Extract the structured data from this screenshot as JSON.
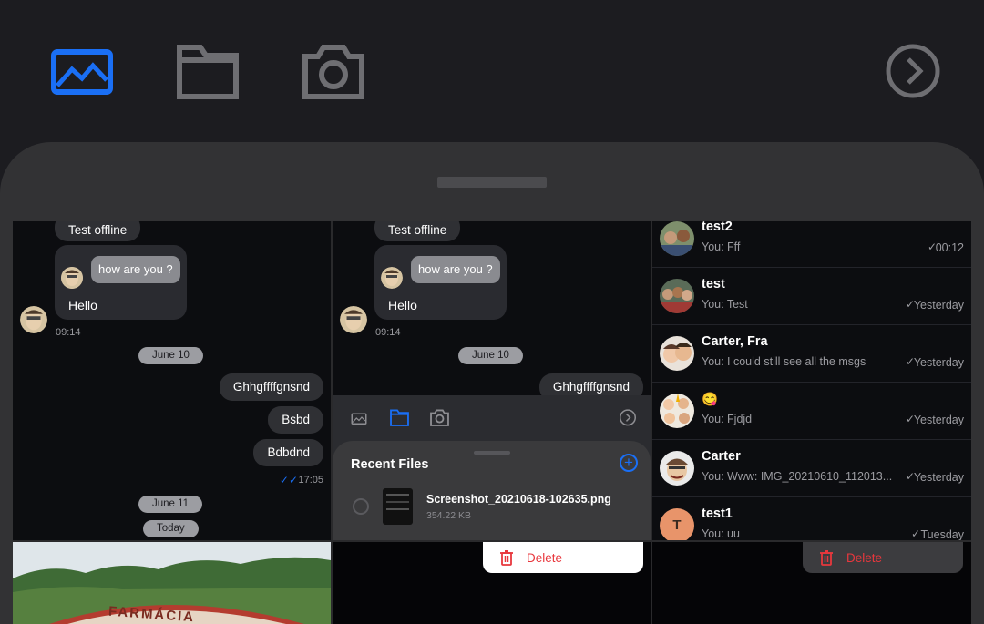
{
  "toolbar": {
    "icons": [
      "gallery-icon",
      "folder-icon",
      "camera-icon",
      "next-icon"
    ],
    "active_color": "#1a6ff5",
    "inactive_color": "#6e6e72"
  },
  "chat": {
    "offline_label": "Test offline",
    "incoming_question": "how are you ?",
    "incoming_reply": "Hello",
    "incoming_time": "09:14",
    "date_chip_1": "June 10",
    "outgoing": [
      "Ghhgffffgnsnd",
      "Bsbd",
      "Bdbdnd"
    ],
    "outgoing_time": "17:05",
    "date_chip_2": "June 11",
    "date_chip_3": "Today"
  },
  "attach_panel": {
    "recent_files_title": "Recent Files",
    "file_name": "Screenshot_20210618-102635.png",
    "file_size": "354.22 KB"
  },
  "conversations": [
    {
      "name": "test2",
      "preview": "You: Fff",
      "when": "00:12"
    },
    {
      "name": "test",
      "preview": "You: Test",
      "when": "Yesterday"
    },
    {
      "name": "Carter, Fra",
      "preview": "You: I could still see all the msgs",
      "when": "Yesterday"
    },
    {
      "name": "😋",
      "preview": "You: Fjdjd",
      "when": "Yesterday"
    },
    {
      "name": "Carter",
      "preview": "You: Www: IMG_20210610_112013...",
      "when": "Yesterday"
    },
    {
      "name": "test1",
      "preview": "You: uu",
      "when": "Tuesday",
      "initial": "T"
    }
  ],
  "photo_caption": "FARMÁCIA",
  "delete_label": "Delete",
  "colors": {
    "accent": "#1a6ff5",
    "danger": "#e8373d"
  }
}
